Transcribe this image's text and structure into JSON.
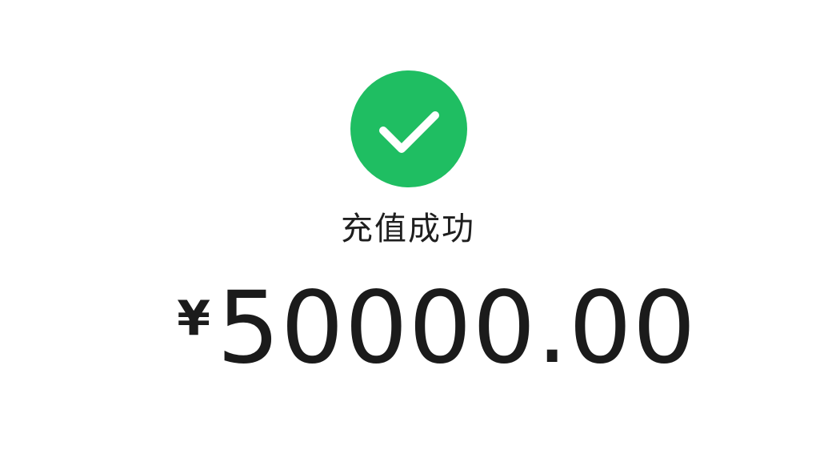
{
  "status": {
    "icon": "check-icon",
    "text": "充值成功",
    "color": "#1fbe62"
  },
  "amount": {
    "currency": "¥",
    "value": "50000.00"
  }
}
